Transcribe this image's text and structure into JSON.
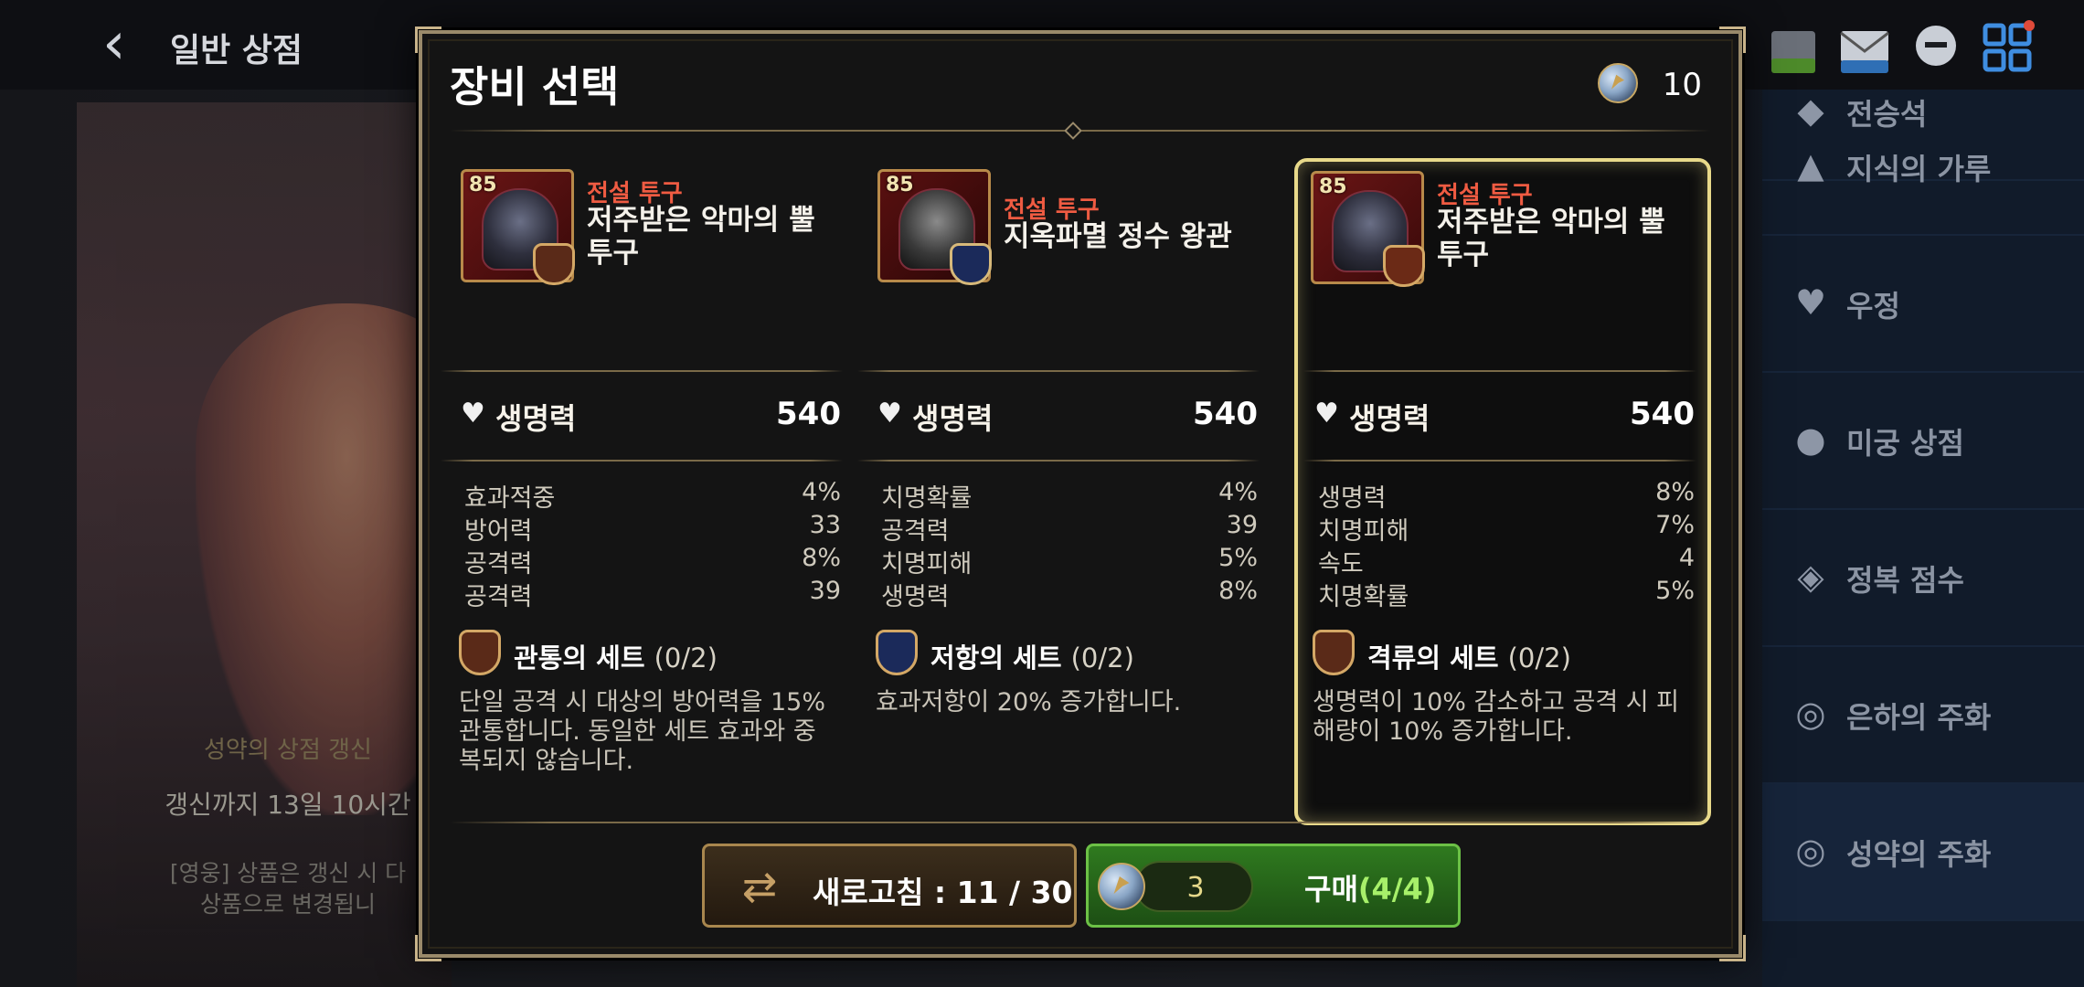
{
  "header": {
    "back_icon": "chevron-left-icon",
    "title": "일반 상점"
  },
  "top_icons": [
    "free-shop-icon",
    "mail-event-icon",
    "chat-icon",
    "menu-grid-icon"
  ],
  "side_menu": [
    {
      "label": "전승석",
      "icon": "stone-icon"
    },
    {
      "label": "지식의 가루",
      "icon": "powder-icon"
    },
    {
      "label": "우정",
      "icon": "heart-icon"
    },
    {
      "label": "미궁 상점",
      "icon": "labyrinth-icon"
    },
    {
      "label": "정복 점수",
      "icon": "conquest-icon"
    },
    {
      "label": "은하의 주화",
      "icon": "galaxy-coin-icon"
    },
    {
      "label": "성약의 주화",
      "icon": "covenant-coin-icon"
    }
  ],
  "background_info": {
    "title": "성약의 상점 갱신",
    "time": "갱신까지 13일 10시간",
    "desc_line1": "[영웅] 상품은 갱신 시 다",
    "desc_line2": "상품으로 변경됩니"
  },
  "modal": {
    "title": "장비 선택",
    "currency_count": "10",
    "colors": {
      "accent_gold": "#c9b48a",
      "grade_red": "#ef5b42",
      "buy_green": "#2f7a1f"
    }
  },
  "cards": [
    {
      "level": "85",
      "grade": "전설 투구",
      "name": "저주받은 악마의 뿔 투구",
      "hp_label": "생명력",
      "hp_value": "540",
      "stats": [
        {
          "name": "효과적중",
          "value": "4%"
        },
        {
          "name": "방어력",
          "value": "33"
        },
        {
          "name": "공격력",
          "value": "8%"
        },
        {
          "name": "공격력",
          "value": "39"
        }
      ],
      "set_name": "관통의 세트",
      "set_count": "(0/2)",
      "set_desc": "단일 공격 시 대상의 방어력을 15% 관통합니다. 동일한 세트 효과와 중복되지 않습니다.",
      "selected": false
    },
    {
      "level": "85",
      "grade": "전설 투구",
      "name": "지옥파멸 정수 왕관",
      "hp_label": "생명력",
      "hp_value": "540",
      "stats": [
        {
          "name": "치명확률",
          "value": "4%"
        },
        {
          "name": "공격력",
          "value": "39"
        },
        {
          "name": "치명피해",
          "value": "5%"
        },
        {
          "name": "생명력",
          "value": "8%"
        }
      ],
      "set_name": "저항의 세트",
      "set_count": "(0/2)",
      "set_desc": "효과저항이 20% 증가합니다.",
      "selected": false
    },
    {
      "level": "85",
      "grade": "전설 투구",
      "name": "저주받은 악마의 뿔 투구",
      "hp_label": "생명력",
      "hp_value": "540",
      "stats": [
        {
          "name": "생명력",
          "value": "8%"
        },
        {
          "name": "치명피해",
          "value": "7%"
        },
        {
          "name": "속도",
          "value": "4"
        },
        {
          "name": "치명확률",
          "value": "5%"
        }
      ],
      "set_name": "격류의 세트",
      "set_count": "(0/2)",
      "set_desc": "생명력이 10% 감소하고 공격 시 피해량이 10% 증가합니다.",
      "selected": true
    }
  ],
  "buttons": {
    "refresh_label": "새로고침 : 11 / 30",
    "price": "3",
    "buy_label": "구매",
    "buy_count": "(4/4)"
  }
}
